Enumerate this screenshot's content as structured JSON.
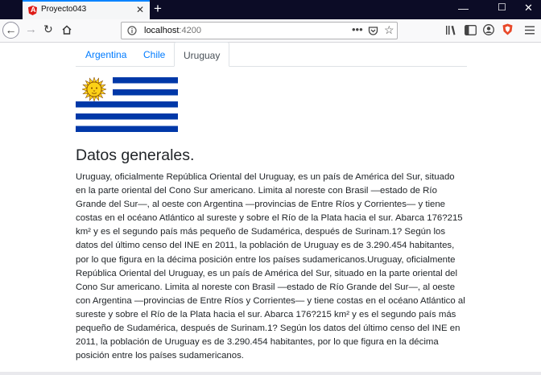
{
  "browser": {
    "tab_title": "Proyecto043",
    "new_tab_symbol": "+",
    "url_host": "localhost",
    "url_port": ":4200",
    "colors": {
      "chrome_dark": "#0c0c26",
      "accent": "#0a84ff"
    }
  },
  "nav": {
    "tabs": [
      {
        "label": "Argentina"
      },
      {
        "label": "Chile"
      },
      {
        "label": "Uruguay"
      }
    ]
  },
  "main": {
    "heading": "Datos generales.",
    "paragraph": "Uruguay, oficialmente República Oriental del Uruguay, es un país de América del Sur, situado en la parte oriental del Cono Sur americano. Limita al noreste con Brasil —estado de Río Grande del Sur—, al oeste con Argentina —provincias de Entre Ríos y Corrientes— y tiene costas en el océano Atlántico al sureste y sobre el Río de la Plata hacia el sur. Abarca 176?215 km² y es el segundo país más pequeño de Sudamérica, después de Surinam.1? Según los datos del último censo del INE en 2011, la población de Uruguay es de 3.290.454 habitantes, por lo que figura en la décima posición entre los países sudamericanos.Uruguay, oficialmente República Oriental del Uruguay, es un país de América del Sur, situado en la parte oriental del Cono Sur americano. Limita al noreste con Brasil —estado de Río Grande del Sur—, al oeste con Argentina —provincias de Entre Ríos y Corrientes— y tiene costas en el océano Atlántico al sureste y sobre el Río de la Plata hacia el sur. Abarca 176?215 km² y es el segundo país más pequeño de Sudamérica, después de Surinam.1? Según los datos del último censo del INE en 2011, la población de Uruguay es de 3.290.454 habitantes, por lo que figura en la décima posición entre los países sudamericanos."
  },
  "flag": {
    "colors": {
      "blue": "#0038a8",
      "sun": "#fcd116",
      "sun_outline": "#7b3f00"
    }
  }
}
